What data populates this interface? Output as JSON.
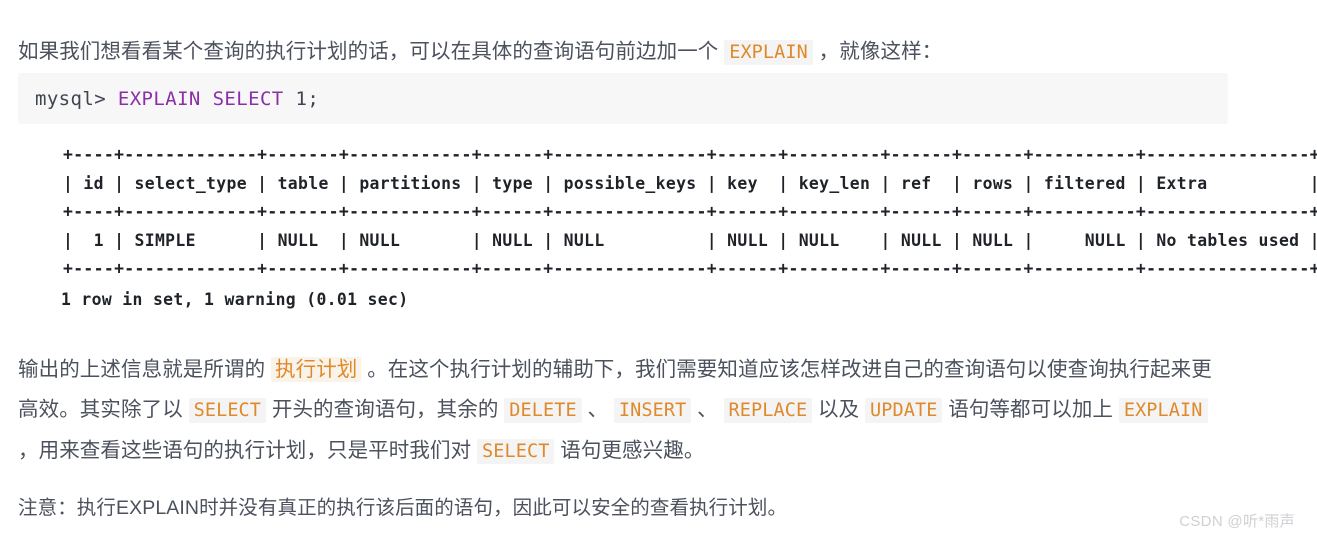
{
  "page": {
    "background_color": "#ffffff",
    "text_color": "#4c515e",
    "accent_color": "#e0892a",
    "keyword_color": "#8b2fa8",
    "code_block_bg": "#f7f7f8",
    "inline_code_bg": "#f4f4f5"
  },
  "intro_paragraph": {
    "text_before": "如果我们想看看某个查询的执行计划的话，可以在具体的查询语句前边加一个 ",
    "code": "EXPLAIN",
    "text_after": " ，就像这样："
  },
  "code_block": {
    "prompt": "mysql> ",
    "keyword_explain": "EXPLAIN",
    "space_1": " ",
    "keyword_select": "SELECT",
    "literal": " 1;"
  },
  "result_table": {
    "border_line": "+----+-------------+-------+------------+------+---------------+------+---------+------+------+----------+----------------+",
    "header_line": "| id | select_type | table | partitions | type | possible_keys | key  | key_len | ref  | rows | filtered | Extra          |",
    "row_line": "|  1 | SIMPLE      | NULL  | NULL       | NULL | NULL          | NULL | NULL    | NULL | NULL |     NULL | No tables used |",
    "columns": [
      "id",
      "select_type",
      "table",
      "partitions",
      "type",
      "possible_keys",
      "key",
      "key_len",
      "ref",
      "rows",
      "filtered",
      "Extra"
    ],
    "rows": [
      [
        "1",
        "SIMPLE",
        "NULL",
        "NULL",
        "NULL",
        "NULL",
        "NULL",
        "NULL",
        "NULL",
        "NULL",
        "NULL",
        "No tables used"
      ]
    ],
    "status_line": "1 row in set, 1 warning (0.01 sec)"
  },
  "body_paragraph": {
    "seg_1": "输出的上述信息就是所谓的 ",
    "hl_1": "执行计划",
    "seg_2": " 。在这个执行计划的辅助下，我们需要知道应该怎样改进自己的查询语句以使查询执行起来更高效。其实除了以 ",
    "code_select_1": "SELECT",
    "seg_3": " 开头的查询语句，其余的 ",
    "code_delete": "DELETE",
    "seg_4": " 、 ",
    "code_insert": "INSERT",
    "seg_5": " 、 ",
    "code_replace": "REPLACE",
    "seg_6": " 以及 ",
    "code_update": "UPDATE",
    "seg_7": " 语句等都可以加上 ",
    "code_explain": "EXPLAIN",
    "seg_8": " ，用来查看这些语句的执行计划，只是平时我们对 ",
    "code_select_2": "SELECT",
    "seg_9": " 语句更感兴趣。"
  },
  "note_paragraph": {
    "text": "注意：执行EXPLAIN时并没有真正的执行该后面的语句，因此可以安全的查看执行计划。"
  },
  "watermark": {
    "text": "CSDN @听*雨声"
  }
}
